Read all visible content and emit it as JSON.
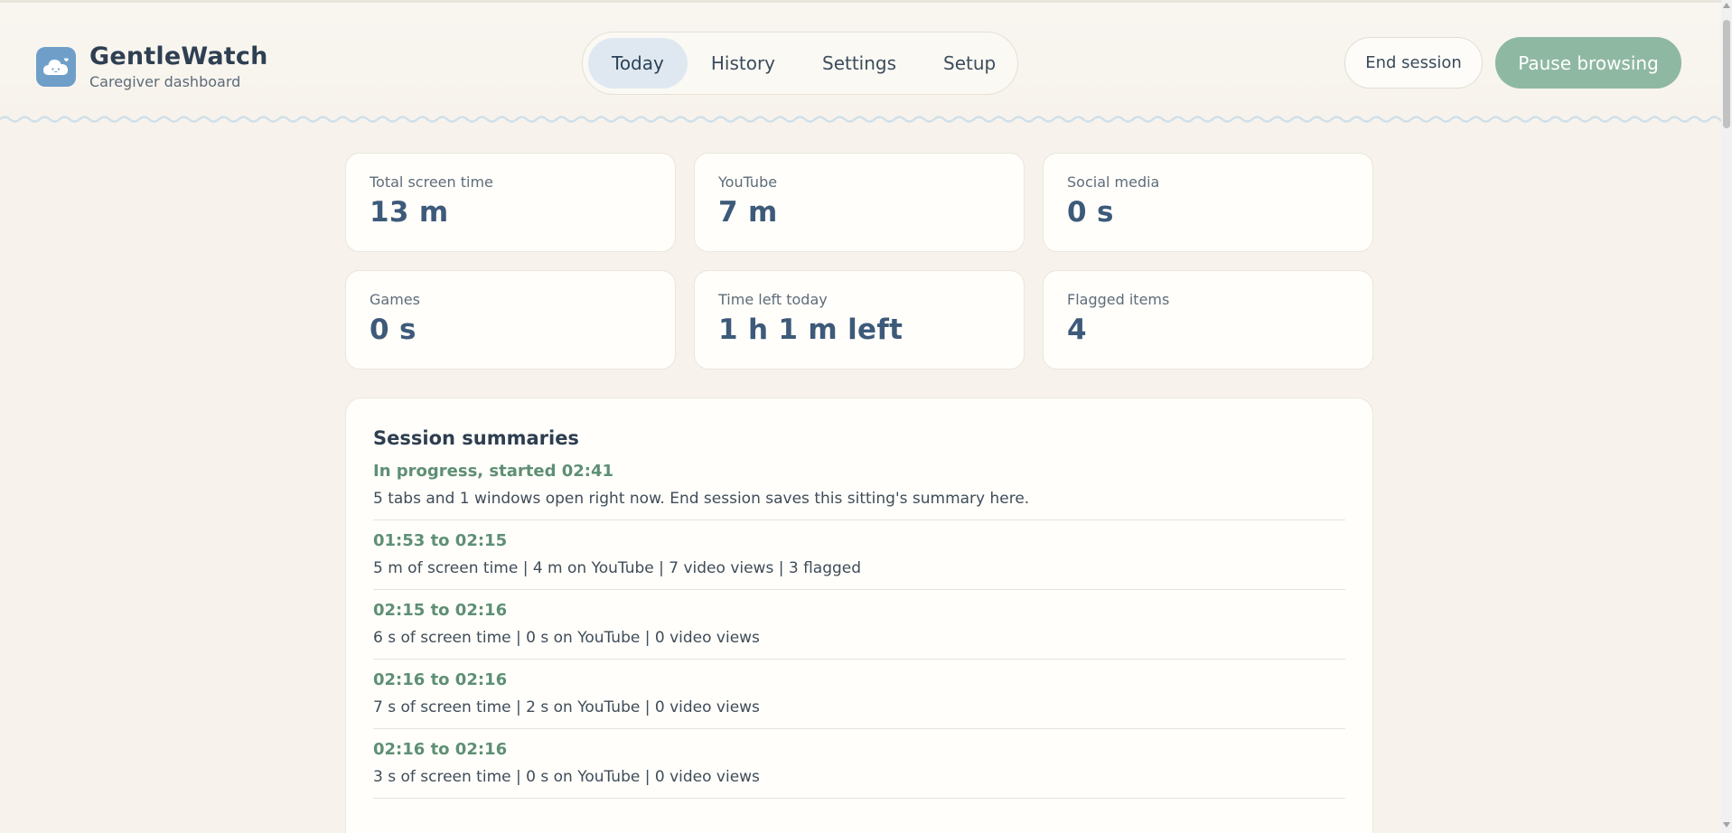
{
  "brand": {
    "title": "GentleWatch",
    "subtitle": "Caregiver dashboard",
    "logo_icon": "cloud-face-icon",
    "logo_color": "#6f9fc9"
  },
  "nav": {
    "tabs": [
      {
        "label": "Today",
        "active": true
      },
      {
        "label": "History",
        "active": false
      },
      {
        "label": "Settings",
        "active": false
      },
      {
        "label": "Setup",
        "active": false
      }
    ]
  },
  "actions": {
    "end_session": "End session",
    "pause_browsing": "Pause browsing",
    "pause_color": "#8fb8a2"
  },
  "stats": [
    {
      "label": "Total screen time",
      "value": "13 m"
    },
    {
      "label": "YouTube",
      "value": "7 m"
    },
    {
      "label": "Social media",
      "value": "0 s"
    },
    {
      "label": "Games",
      "value": "0 s"
    },
    {
      "label": "Time left today",
      "value": "1 h 1 m left"
    },
    {
      "label": "Flagged items",
      "value": "4"
    }
  ],
  "sessions": {
    "title": "Session summaries",
    "items": [
      {
        "time": "In progress, started 02:41",
        "desc": "5 tabs and 1 windows open right now. End session saves this sitting's summary here."
      },
      {
        "time": "01:53 to 02:15",
        "desc": "5 m of screen time | 4 m on YouTube | 7 video views | 3 flagged"
      },
      {
        "time": "02:15 to 02:16",
        "desc": "6 s of screen time | 0 s on YouTube | 0 video views"
      },
      {
        "time": "02:16 to 02:16",
        "desc": "7 s of screen time | 2 s on YouTube | 0 video views"
      },
      {
        "time": "02:16 to 02:16",
        "desc": "3 s of screen time | 0 s on YouTube | 0 video views"
      }
    ]
  },
  "colors": {
    "background": "#f7f3ec",
    "accent_value": "#3d5a7a",
    "session_time": "#5e8f74"
  }
}
